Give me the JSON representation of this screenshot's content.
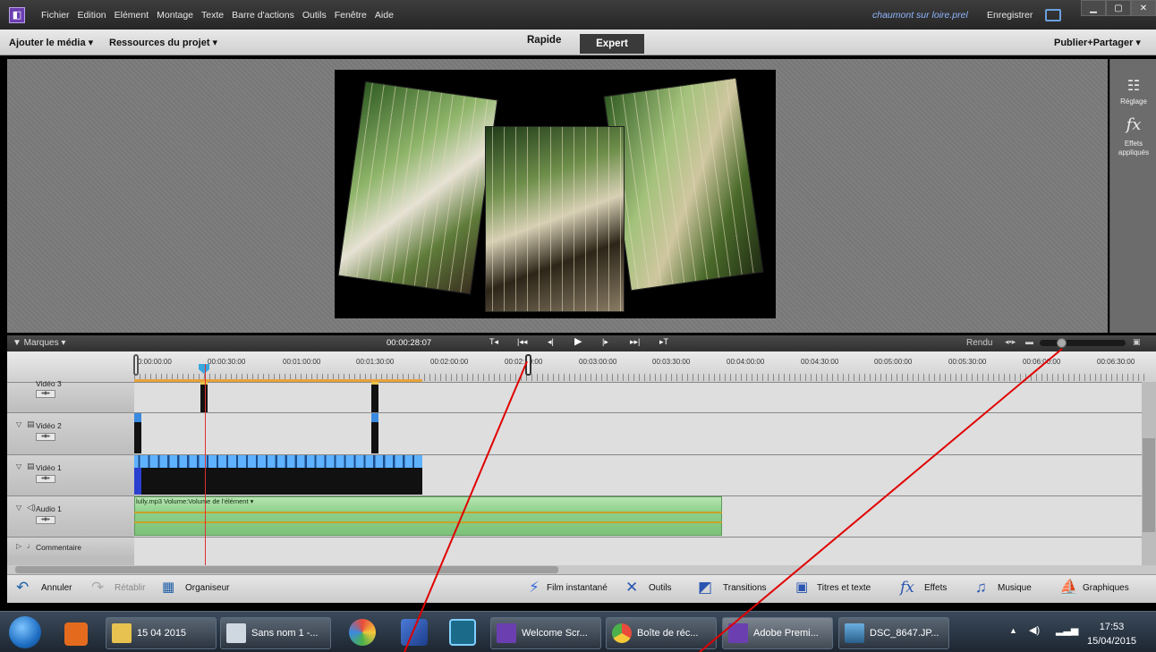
{
  "menu": {
    "items": [
      "Fichier",
      "Edition",
      "Elément",
      "Montage",
      "Texte",
      "Barre d'actions",
      "Outils",
      "Fenêtre",
      "Aide"
    ],
    "project_name": "chaumont sur loire.prel",
    "save_label": "Enregistrer"
  },
  "toolbar": {
    "add_media": "Ajouter le média ▾",
    "project_assets": "Ressources du projet ▾",
    "mode_quick": "Rapide",
    "mode_expert": "Expert",
    "publish": "Publier+Partager ▾"
  },
  "right_panel": {
    "adjust_label": "Réglage",
    "effects_label": "Effets appliqués"
  },
  "controls": {
    "markers": "▼ Marques  ▾",
    "timecode": "00:00:28:07",
    "render": "Rendu"
  },
  "ruler": {
    "labels": [
      "0:00:00:00",
      "00:00:30:00",
      "00:01:00:00",
      "00:01:30:00",
      "00:02:00:00",
      "00:02:30:00",
      "00:03:00:00",
      "00:03:30:00",
      "00:04:00:00",
      "00:04:30:00",
      "00:05:00:00",
      "00:05:30:00",
      "00:06:00:00",
      "00:06:30:00"
    ]
  },
  "tracks": {
    "video3": "Vidéo 3",
    "video2": "Vidéo 2",
    "video1": "Vidéo 1",
    "audio1": "Audio 1",
    "comment": "Commentaire",
    "audio_clip_label": "lully.mp3  Volume:Volume de l'élément ▾"
  },
  "bottom": {
    "undo": "Annuler",
    "redo": "Rétablir",
    "organizer": "Organiseur",
    "instant_movie": "Film instantané",
    "tools": "Outils",
    "transitions": "Transitions",
    "titles": "Titres et texte",
    "effects": "Effets",
    "music": "Musique",
    "graphics": "Graphiques"
  },
  "taskbar": {
    "folder": "15 04 2015",
    "sans_nom": "Sans nom 1 -...",
    "welcome": "Welcome Scr...",
    "chrome": "Boîte de réc...",
    "premiere": "Adobe Premi...",
    "photo": "DSC_8647.JP...",
    "time": "17:53",
    "date": "15/04/2015"
  },
  "colors": {
    "accent_purple": "#6b3fb0",
    "annotation_red": "#e00000",
    "playhead_red": "#e03030"
  }
}
